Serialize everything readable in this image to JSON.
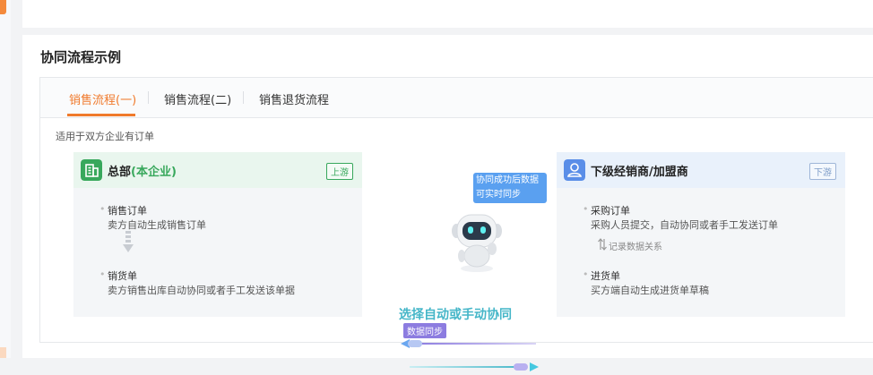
{
  "section": {
    "title": "协同流程示例"
  },
  "tabs": [
    {
      "label": "销售流程(一)",
      "active": true
    },
    {
      "label": "销售流程(二)",
      "active": false
    },
    {
      "label": "销售退货流程",
      "active": false
    }
  ],
  "note": "适用于双方企业有订单",
  "upstream": {
    "title_main": "总部",
    "title_accent": "(本企业)",
    "badge": "上游",
    "items": [
      {
        "title": "销售订单",
        "desc": "卖方自动生成销售订单"
      },
      {
        "title": "销货单",
        "desc": "卖方销售出库自动协同或者手工发送该单据"
      }
    ]
  },
  "downstream": {
    "title": "下级经销商/加盟商",
    "badge": "下游",
    "items": [
      {
        "title": "采购订单",
        "desc": "采购人员提交，自动协同或者手工发送订单"
      },
      {
        "title": "进货单",
        "desc": "买方端自动生成进货单草稿"
      }
    ],
    "relation": "记录数据关系"
  },
  "bubble": {
    "line1": "协同成功后数据",
    "line2": "可实时同步"
  },
  "sync_tag": "数据同步",
  "choice_text": "选择自动或手动协同",
  "colors": {
    "accent": "#f07a2c",
    "green": "#38a85c",
    "teal": "#45b6c8",
    "bubble": "#5aa0f0",
    "purple": "#8c7ce0"
  }
}
